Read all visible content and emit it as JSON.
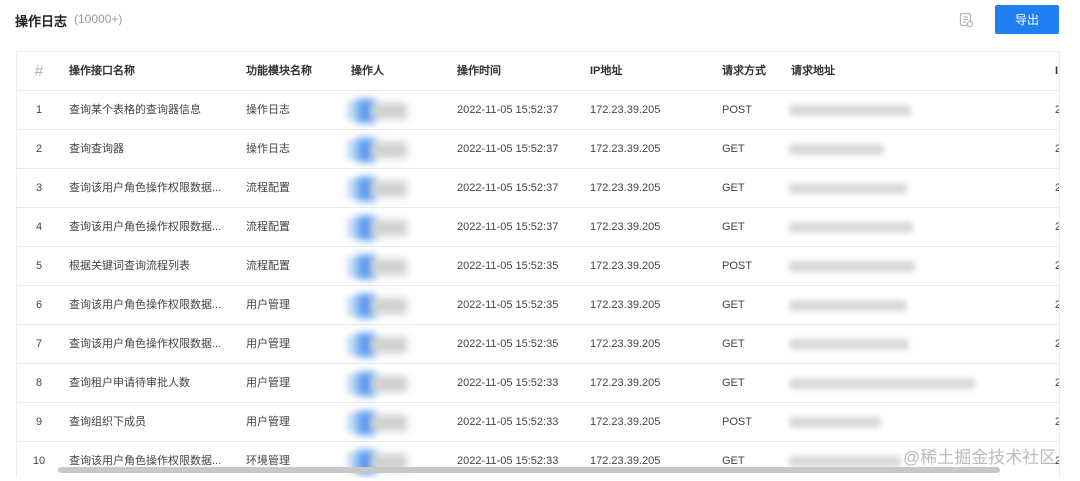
{
  "header": {
    "title": "操作日志",
    "count": "(10000+)",
    "export_label": "导出",
    "icon": "document-icon"
  },
  "table": {
    "columns": {
      "index": "#",
      "name": "操作接口名称",
      "module": "功能模块名称",
      "operator": "操作人",
      "time": "操作时间",
      "ip": "IP地址",
      "method": "请求方式",
      "url": "请求地址",
      "extra": "I"
    },
    "rows": [
      {
        "index": "1",
        "name": "查询某个表格的查询器信息",
        "module": "操作日志",
        "time": "2022-11-05 15:52:37",
        "ip": "172.23.39.205",
        "method": "POST",
        "extra": "2"
      },
      {
        "index": "2",
        "name": "查询查询器",
        "module": "操作日志",
        "time": "2022-11-05 15:52:37",
        "ip": "172.23.39.205",
        "method": "GET",
        "extra": "2"
      },
      {
        "index": "3",
        "name": "查询该用户角色操作权限数据...",
        "module": "流程配置",
        "time": "2022-11-05 15:52:37",
        "ip": "172.23.39.205",
        "method": "GET",
        "extra": "2"
      },
      {
        "index": "4",
        "name": "查询该用户角色操作权限数据...",
        "module": "流程配置",
        "time": "2022-11-05 15:52:37",
        "ip": "172.23.39.205",
        "method": "GET",
        "extra": "2"
      },
      {
        "index": "5",
        "name": "根据关键词查询流程列表",
        "module": "流程配置",
        "time": "2022-11-05 15:52:35",
        "ip": "172.23.39.205",
        "method": "POST",
        "extra": "2"
      },
      {
        "index": "6",
        "name": "查询该用户角色操作权限数据...",
        "module": "用户管理",
        "time": "2022-11-05 15:52:35",
        "ip": "172.23.39.205",
        "method": "GET",
        "extra": "2"
      },
      {
        "index": "7",
        "name": "查询该用户角色操作权限数据...",
        "module": "用户管理",
        "time": "2022-11-05 15:52:35",
        "ip": "172.23.39.205",
        "method": "GET",
        "extra": "2"
      },
      {
        "index": "8",
        "name": "查询租户申请待审批人数",
        "module": "用户管理",
        "time": "2022-11-05 15:52:33",
        "ip": "172.23.39.205",
        "method": "GET",
        "extra": "2"
      },
      {
        "index": "9",
        "name": "查询组织下成员",
        "module": "用户管理",
        "time": "2022-11-05 15:52:33",
        "ip": "172.23.39.205",
        "method": "POST",
        "extra": "2"
      },
      {
        "index": "10",
        "name": "查询该用户角色操作权限数据...",
        "module": "环境管理",
        "time": "2022-11-05 15:52:33",
        "ip": "172.23.39.205",
        "method": "GET",
        "extra": "2"
      }
    ]
  },
  "watermark": "@稀土掘金技术社区",
  "colors": {
    "primary": "#1f7ff0",
    "border": "#ebebeb",
    "muted": "#9a9a9a"
  }
}
